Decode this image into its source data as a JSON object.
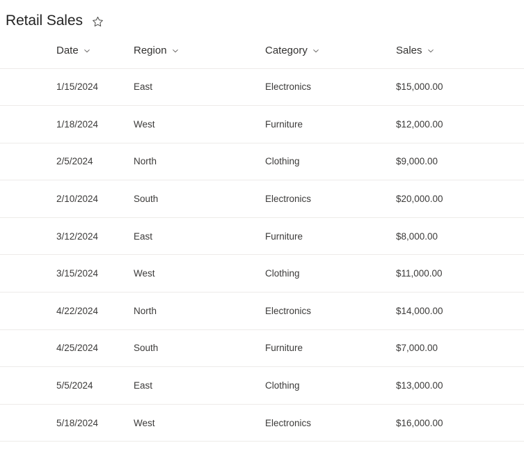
{
  "header": {
    "title": "Retail Sales",
    "favorite_icon": "star-outline-icon",
    "favorited": false
  },
  "table": {
    "sort_icon": "chevron-down-icon",
    "columns": [
      {
        "key": "date",
        "label": "Date"
      },
      {
        "key": "region",
        "label": "Region"
      },
      {
        "key": "category",
        "label": "Category"
      },
      {
        "key": "sales",
        "label": "Sales"
      }
    ],
    "rows": [
      {
        "date": "1/15/2024",
        "region": "East",
        "category": "Electronics",
        "sales": "$15,000.00"
      },
      {
        "date": "1/18/2024",
        "region": "West",
        "category": "Furniture",
        "sales": "$12,000.00"
      },
      {
        "date": "2/5/2024",
        "region": "North",
        "category": "Clothing",
        "sales": "$9,000.00"
      },
      {
        "date": "2/10/2024",
        "region": "South",
        "category": "Electronics",
        "sales": "$20,000.00"
      },
      {
        "date": "3/12/2024",
        "region": "East",
        "category": "Furniture",
        "sales": "$8,000.00"
      },
      {
        "date": "3/15/2024",
        "region": "West",
        "category": "Clothing",
        "sales": "$11,000.00"
      },
      {
        "date": "4/22/2024",
        "region": "North",
        "category": "Electronics",
        "sales": "$14,000.00"
      },
      {
        "date": "4/25/2024",
        "region": "South",
        "category": "Furniture",
        "sales": "$7,000.00"
      },
      {
        "date": "5/5/2024",
        "region": "East",
        "category": "Clothing",
        "sales": "$13,000.00"
      },
      {
        "date": "5/18/2024",
        "region": "West",
        "category": "Electronics",
        "sales": "$16,000.00"
      }
    ]
  },
  "colors": {
    "background": "#ffffff",
    "title_text": "#242424",
    "header_text": "#323130",
    "cell_text": "#3b3a39",
    "divider": "#edebe9",
    "icon": "#605e5c"
  }
}
